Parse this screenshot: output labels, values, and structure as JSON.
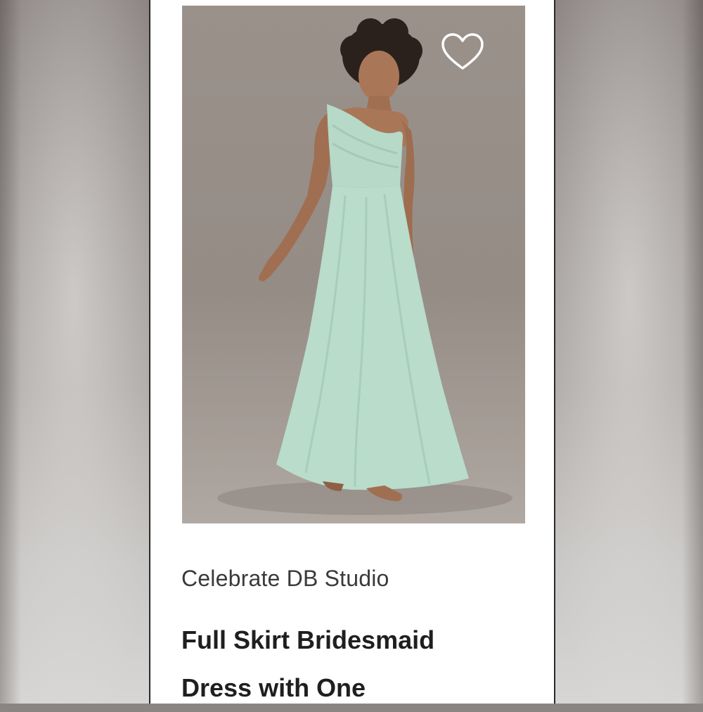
{
  "product": {
    "brand": "Celebrate DB Studio",
    "title_line1": "Full Skirt Bridesmaid",
    "title_line2": "Dress with One"
  },
  "icons": {
    "wishlist": "heart-outline-icon"
  },
  "colors": {
    "dress": "#b9dccb",
    "photo_background": "#978e88",
    "text_dark": "#1f1f1f",
    "text_brand": "#3a3a3a"
  }
}
